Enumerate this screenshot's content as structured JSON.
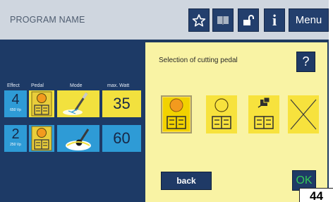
{
  "header": {
    "program_name": "PROGRAM NAME",
    "menu_label": "Menu",
    "info_glyph": "i",
    "icons": [
      "star-icon",
      "book-icon",
      "unlock-icon",
      "info-icon"
    ]
  },
  "table": {
    "columns": [
      "Effect",
      "Pedal",
      "Mode",
      "max. Watt"
    ],
    "rows": [
      {
        "effect": "4",
        "voltage": "650 Vp",
        "max_watt": "35",
        "pedal_icon": "orange-pedal-icon",
        "mode_icon": "cutting-electrode-icon"
      },
      {
        "effect": "2",
        "voltage": "250 Vp",
        "max_watt": "60",
        "pedal_icon": "orange-pedal-icon",
        "mode_icon": "ball-electrode-icon"
      }
    ]
  },
  "dialog": {
    "title": "Selection of cutting pedal",
    "help_label": "?",
    "options": [
      "orange-pedal-selected",
      "yellow-pedal",
      "remote-pedal",
      "no-pedal"
    ],
    "back_label": "back",
    "ok_label": "OK"
  },
  "figure_number": "44",
  "colors": {
    "header_bg": "#cfd6df",
    "button_navy": "#233f6d",
    "cell_blue": "#2e9bd6",
    "cell_yellow": "#f2e13e",
    "dialog_bg": "#f9f3a4",
    "ok_green": "#34c759",
    "pedal_orange": "#f39a1e"
  }
}
